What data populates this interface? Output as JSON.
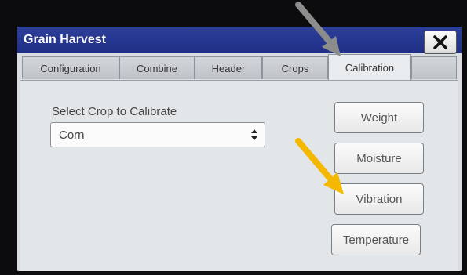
{
  "window": {
    "title": "Grain Harvest"
  },
  "tabs": [
    {
      "label": "Configuration"
    },
    {
      "label": "Combine"
    },
    {
      "label": "Header"
    },
    {
      "label": "Crops"
    },
    {
      "label": "Calibration"
    }
  ],
  "active_tab": "Calibration",
  "crop_select": {
    "label": "Select Crop to Calibrate",
    "value": "Corn"
  },
  "buttons": [
    {
      "label": "Weight"
    },
    {
      "label": "Moisture"
    },
    {
      "label": "Vibration"
    },
    {
      "label": "Temperature"
    }
  ],
  "annotations": {
    "gray_arrow_color": "#8c8c8c",
    "yellow_arrow_color": "#f5b800"
  },
  "colors": {
    "titlebar": "#1f2f86",
    "panel": "#e3e6e9"
  }
}
